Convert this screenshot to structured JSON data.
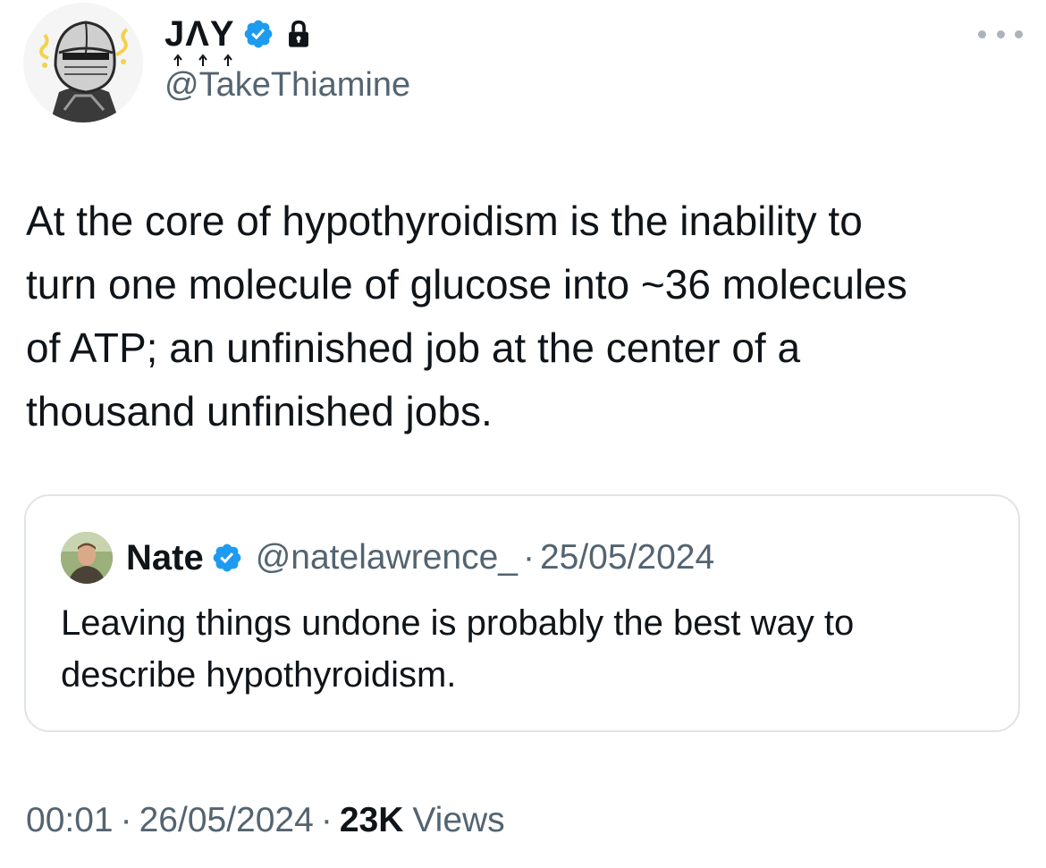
{
  "author": {
    "display_name": "JΛY",
    "handle": "@TakeThiamine",
    "verified": true,
    "protected": true,
    "avatar_icon": "knight-helmet-avatar"
  },
  "tweet": {
    "text": "At the core of hypothyroidism is the inability to\nturn one molecule of glucose into ~36 molecules\nof ATP; an unfinished job at the center of a\nthousand unfinished jobs.",
    "time": "00:01",
    "date": "26/05/2024",
    "views_count": "23K",
    "views_label": "Views",
    "separator": "·"
  },
  "quote": {
    "display_name": "Nate",
    "handle": "@natelawrence_",
    "date": "25/05/2024",
    "separator": "·",
    "verified": true,
    "text": "Leaving things undone is probably the best way to\ndescribe hypothyroidism.",
    "avatar_icon": "person-photo-avatar"
  },
  "colors": {
    "text_primary": "#0f1419",
    "text_secondary": "#536471",
    "verified_blue": "#1d9bf0",
    "border": "#dfe4e8"
  },
  "icons": {
    "verified": "verified-badge-icon",
    "lock": "lock-icon",
    "more": "more-options-icon"
  }
}
